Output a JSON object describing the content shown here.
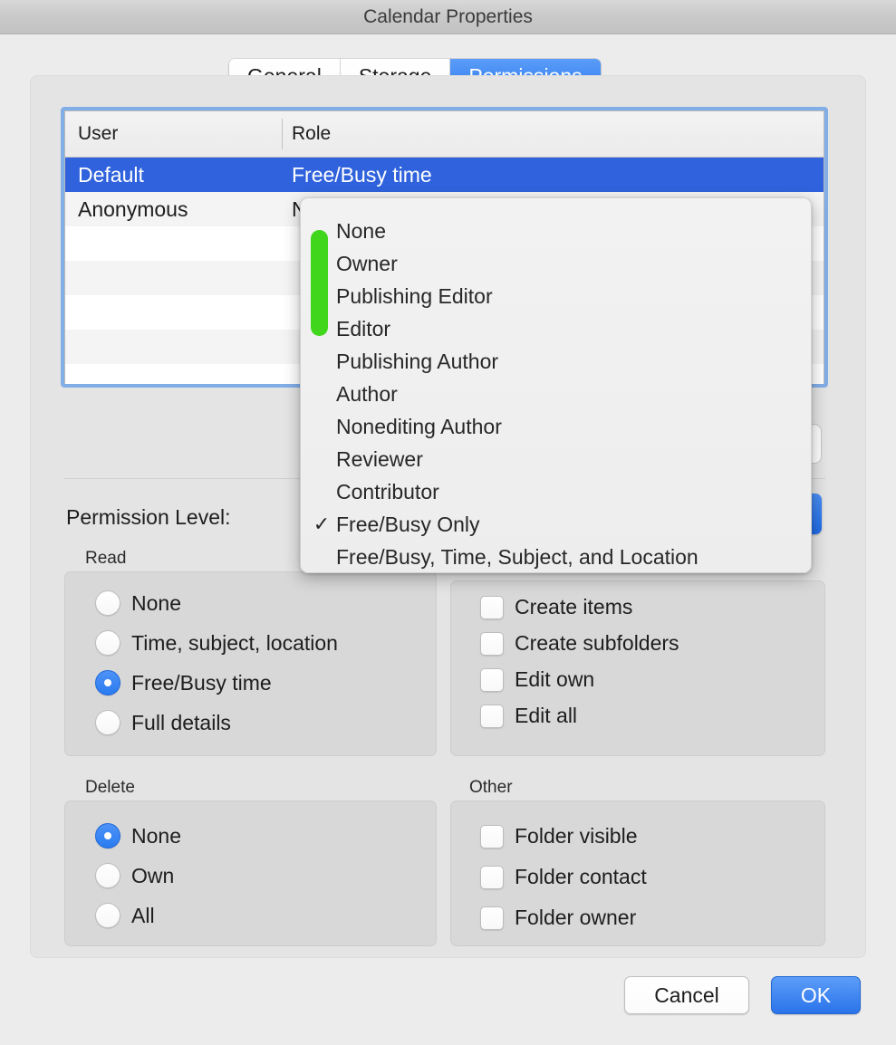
{
  "window": {
    "title": "Calendar Properties"
  },
  "tabs": [
    {
      "label": "General",
      "active": false
    },
    {
      "label": "Storage",
      "active": false
    },
    {
      "label": "Permissions",
      "active": true
    }
  ],
  "table": {
    "columns": [
      "User",
      "Role"
    ],
    "rows": [
      {
        "user": "Default",
        "role": "Free/Busy time",
        "selected": true
      },
      {
        "user": "Anonymous",
        "role": "None",
        "selected": false
      },
      {
        "user": "",
        "role": "",
        "selected": false
      },
      {
        "user": "",
        "role": "",
        "selected": false
      },
      {
        "user": "",
        "role": "",
        "selected": false
      },
      {
        "user": "",
        "role": "",
        "selected": false
      },
      {
        "user": "",
        "role": "",
        "selected": false
      }
    ]
  },
  "menu": {
    "name": "role-dropdown",
    "items": [
      {
        "label": "None",
        "checked": false
      },
      {
        "label": "Owner",
        "checked": false
      },
      {
        "label": "Publishing Editor",
        "checked": false
      },
      {
        "label": "Editor",
        "checked": false
      },
      {
        "label": "Publishing Author",
        "checked": false
      },
      {
        "label": "Author",
        "checked": false
      },
      {
        "label": "Nonediting Author",
        "checked": false
      },
      {
        "label": "Reviewer",
        "checked": false
      },
      {
        "label": "Contributor",
        "checked": false
      },
      {
        "label": "Free/Busy Only",
        "checked": true
      },
      {
        "label": "Free/Busy, Time, Subject, and Location",
        "checked": false
      }
    ],
    "check_glyph": "✓",
    "highlight_color": "#3fd61b"
  },
  "permission_level_label": "Permission Level:",
  "groups": {
    "read": {
      "title": "Read",
      "options": [
        {
          "label": "None",
          "selected": false
        },
        {
          "label": "Time, subject, location",
          "selected": false
        },
        {
          "label": "Free/Busy time",
          "selected": true
        },
        {
          "label": "Full details",
          "selected": false
        }
      ]
    },
    "write": {
      "title": "",
      "options": [
        {
          "label": "Create items",
          "checked": false
        },
        {
          "label": "Create subfolders",
          "checked": false
        },
        {
          "label": "Edit own",
          "checked": false
        },
        {
          "label": "Edit all",
          "checked": false
        }
      ]
    },
    "delete": {
      "title": "Delete",
      "options": [
        {
          "label": "None",
          "selected": true
        },
        {
          "label": "Own",
          "selected": false
        },
        {
          "label": "All",
          "selected": false
        }
      ]
    },
    "other": {
      "title": "Other",
      "options": [
        {
          "label": "Folder visible",
          "checked": false
        },
        {
          "label": "Folder contact",
          "checked": false
        },
        {
          "label": "Folder owner",
          "checked": false
        }
      ]
    }
  },
  "buttons": {
    "cancel": "Cancel",
    "ok": "OK"
  },
  "colors": {
    "accent_blue": "#2f62dc",
    "tab_active": "#2f7cf0",
    "menu_highlight_green": "#3fd61b",
    "window_bg": "#ececec",
    "panel_bg": "#e4e4e4"
  }
}
